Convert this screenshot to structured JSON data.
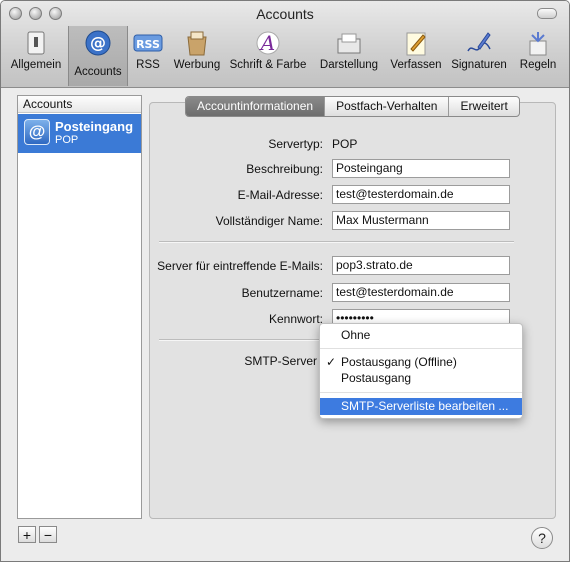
{
  "window": {
    "title": "Accounts"
  },
  "toolbar": {
    "items": [
      {
        "label": "Allgemein",
        "icon": "switch-icon"
      },
      {
        "label": "Accounts",
        "icon": "at-sign-icon"
      },
      {
        "label": "RSS",
        "icon": "rss-icon"
      },
      {
        "label": "Werbung",
        "icon": "junk-mail-icon"
      },
      {
        "label": "Schrift & Farbe",
        "icon": "font-icon"
      },
      {
        "label": "Darstellung",
        "icon": "viewing-icon"
      },
      {
        "label": "Verfassen",
        "icon": "compose-icon"
      },
      {
        "label": "Signaturen",
        "icon": "signature-icon"
      },
      {
        "label": "Regeln",
        "icon": "rules-icon"
      }
    ],
    "rss_badge": "RSS",
    "at_glyph": "@",
    "font_glyph": "A"
  },
  "sidebar": {
    "header": "Accounts",
    "accounts": [
      {
        "name": "Posteingang",
        "type": "POP",
        "icon_glyph": "@"
      }
    ],
    "add_label": "+",
    "remove_label": "−"
  },
  "tabs": [
    {
      "label": "Accountinformationen",
      "active": true
    },
    {
      "label": "Postfach-Verhalten",
      "active": false
    },
    {
      "label": "Erweitert",
      "active": false
    }
  ],
  "form": {
    "servertyp_label": "Servertyp:",
    "servertyp_value": "POP",
    "beschreibung_label": "Beschreibung:",
    "beschreibung_value": "Posteingang",
    "email_label": "E-Mail-Adresse:",
    "email_value": "test@testerdomain.de",
    "name_label": "Vollständiger Name:",
    "name_value": "Max Mustermann",
    "incoming_label": "Server für eintreffende E-Mails:",
    "incoming_value": "pop3.strato.de",
    "user_label": "Benutzername:",
    "user_value": "test@testerdomain.de",
    "password_label": "Kennwort:",
    "password_value": "•••••••••",
    "smtp_label": "SMTP-Server"
  },
  "smtp_menu": {
    "checkmark": "✓",
    "items": [
      {
        "label": "Ohne",
        "checked": false,
        "highlighted": false
      },
      {
        "label": "Postausgang (Offline)",
        "checked": true,
        "highlighted": false
      },
      {
        "label": "Postausgang",
        "checked": false,
        "highlighted": false
      },
      {
        "label": "SMTP-Serverliste bearbeiten ...",
        "checked": false,
        "highlighted": true
      }
    ]
  },
  "help_label": "?",
  "colors": {
    "selection": "#3b7ad6",
    "menu_highlight": "#3d7be0",
    "window_bg": "#ececec"
  }
}
